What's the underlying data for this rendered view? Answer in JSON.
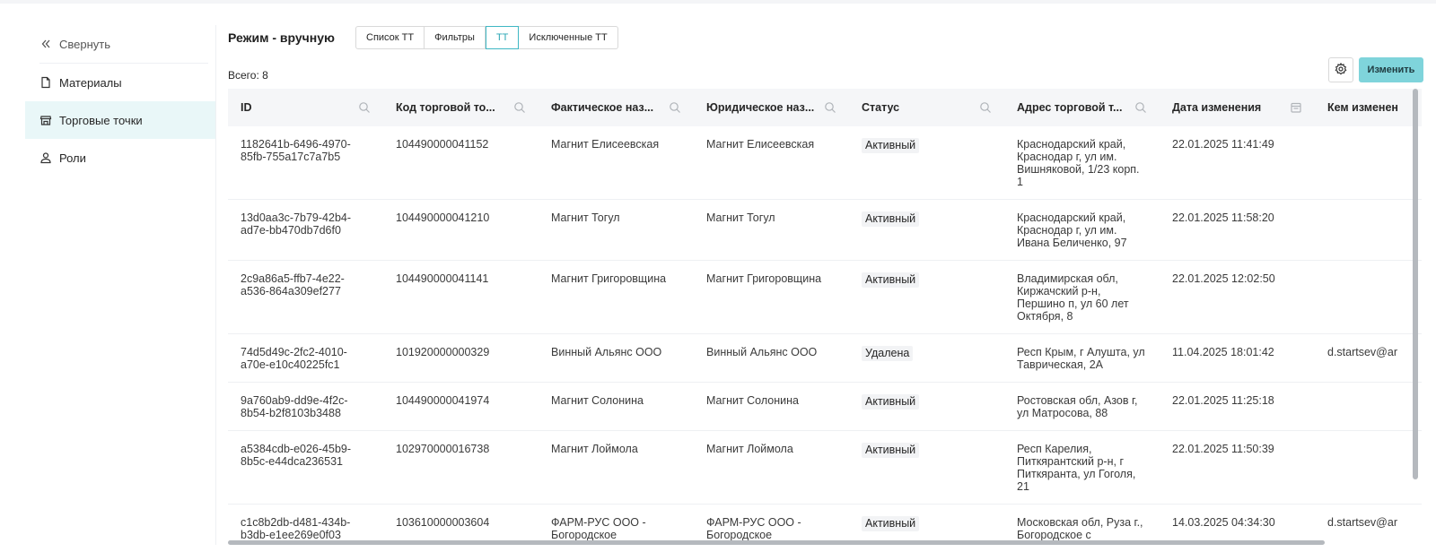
{
  "sidebar": {
    "collapse_label": "Свернуть",
    "items": [
      {
        "label": "Материалы",
        "icon": "file-icon"
      },
      {
        "label": "Торговые точки",
        "icon": "store-icon"
      },
      {
        "label": "Роли",
        "icon": "user-icon"
      }
    ]
  },
  "header": {
    "title": "Режим - вручную",
    "tabs": [
      "Список ТТ",
      "Фильтры",
      "ТТ",
      "Исключенные ТТ"
    ],
    "active_tab": "ТТ",
    "total": "Всего: 8",
    "edit_label": "Изменить"
  },
  "colors": {
    "accent": "#3fb7c4",
    "accent_bg": "#7fd4db",
    "active_sidebar_bg": "#e9f7f8"
  },
  "table": {
    "columns": [
      {
        "label": "ID",
        "icon": "search-icon"
      },
      {
        "label": "Код торговой то...",
        "icon": "search-icon"
      },
      {
        "label": "Фактическое наз...",
        "icon": "search-icon"
      },
      {
        "label": "Юридическое наз...",
        "icon": "search-icon"
      },
      {
        "label": "Статус",
        "icon": "search-icon"
      },
      {
        "label": "Адрес торговой т...",
        "icon": "search-icon"
      },
      {
        "label": "Дата изменения",
        "icon": "calendar-icon"
      },
      {
        "label": "Кем изменен",
        "icon": ""
      }
    ],
    "rows": [
      {
        "id": "1182641b-6496-4970-85fb-755a17c7a7b5",
        "code": "104490000041152",
        "fact_name": "Магнит Елисеевская",
        "legal_name": "Магнит Елисеевская",
        "status": "Активный",
        "address": "Краснодарский край, Краснодар г, ул им. Вишняковой, 1/23 корп. 1",
        "date": "22.01.2025 11:41:49",
        "changed_by": ""
      },
      {
        "id": "13d0aa3c-7b79-42b4-ad7e-bb470db7d6f0",
        "code": "104490000041210",
        "fact_name": "Магнит Тогул",
        "legal_name": "Магнит Тогул",
        "status": "Активный",
        "address": "Краснодарский край, Краснодар г, ул им. Ивана Беличенко, 97",
        "date": "22.01.2025 11:58:20",
        "changed_by": ""
      },
      {
        "id": "2c9a86a5-ffb7-4e22-a536-864a309ef277",
        "code": "104490000041141",
        "fact_name": "Магнит Григоровщина",
        "legal_name": "Магнит Григоровщина",
        "status": "Активный",
        "address": "Владимирская обл, Киржачский р-н, Першино п, ул 60 лет Октября, 8",
        "date": "22.01.2025 12:02:50",
        "changed_by": ""
      },
      {
        "id": "74d5d49c-2fc2-4010-a70e-e10c40225fc1",
        "code": "101920000000329",
        "fact_name": "Винный Альянс ООО",
        "legal_name": "Винный Альянс ООО",
        "status": "Удалена",
        "address": "Респ Крым, г Алушта, ул Таврическая, 2А",
        "date": "11.04.2025 18:01:42",
        "changed_by": "d.startsev@ar"
      },
      {
        "id": "9a760ab9-dd9e-4f2c-8b54-b2f8103b3488",
        "code": "104490000041974",
        "fact_name": "Магнит Солонина",
        "legal_name": "Магнит Солонина",
        "status": "Активный",
        "address": "Ростовская обл, Азов г, ул Матросова, 88",
        "date": "22.01.2025 11:25:18",
        "changed_by": ""
      },
      {
        "id": "a5384cdb-e026-45b9-8b5c-e44dca236531",
        "code": "102970000016738",
        "fact_name": "Магнит Лоймола",
        "legal_name": "Магнит Лоймола",
        "status": "Активный",
        "address": "Респ Карелия, Питкярантский р-н, г Питкяранта, ул Гоголя, 21",
        "date": "22.01.2025 11:50:39",
        "changed_by": ""
      },
      {
        "id": "c1c8b2db-d481-434b-b3db-e1ee269e0f03",
        "code": "103610000003604",
        "fact_name": "ФАРМ-РУС ООО - Богородское",
        "legal_name": "ФАРМ-РУС ООО - Богородское",
        "status": "Активный",
        "address": "Московская обл, Руза г., Богородское с",
        "date": "14.03.2025 04:34:30",
        "changed_by": "d.startsev@ar"
      }
    ]
  }
}
